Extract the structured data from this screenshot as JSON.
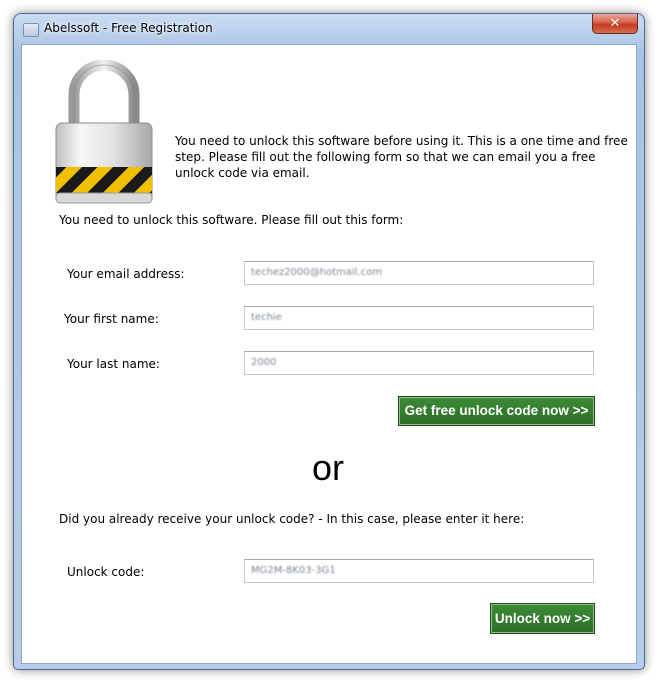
{
  "window": {
    "title": "Abelssoft - Free Registration",
    "close_glyph": "✕"
  },
  "intro_text": "You need to unlock this software before using it. This is a one time and free step. Please fill out the following form so that we can email you a free unlock code via email.",
  "form_heading": "You need to unlock this software. Please fill out this form:",
  "form": {
    "email_label": "Your email address:",
    "email_value": "techez2000@hotmail.com",
    "first_name_label": "Your first name:",
    "first_name_value": "techie",
    "last_name_label": "Your last name:",
    "last_name_value": "2000",
    "get_code_button": "Get free unlock code now >>"
  },
  "or_text": "or",
  "unlock": {
    "question": "Did you already receive your unlock code? - In this case, please enter it here:",
    "code_label": "Unlock code:",
    "code_value": "MG2M-8K03-3G1",
    "unlock_button": "Unlock now >>"
  },
  "colors": {
    "button_green": "#2f7a2a",
    "title_bar": "#a9c4e6",
    "close_red": "#c23a21"
  }
}
